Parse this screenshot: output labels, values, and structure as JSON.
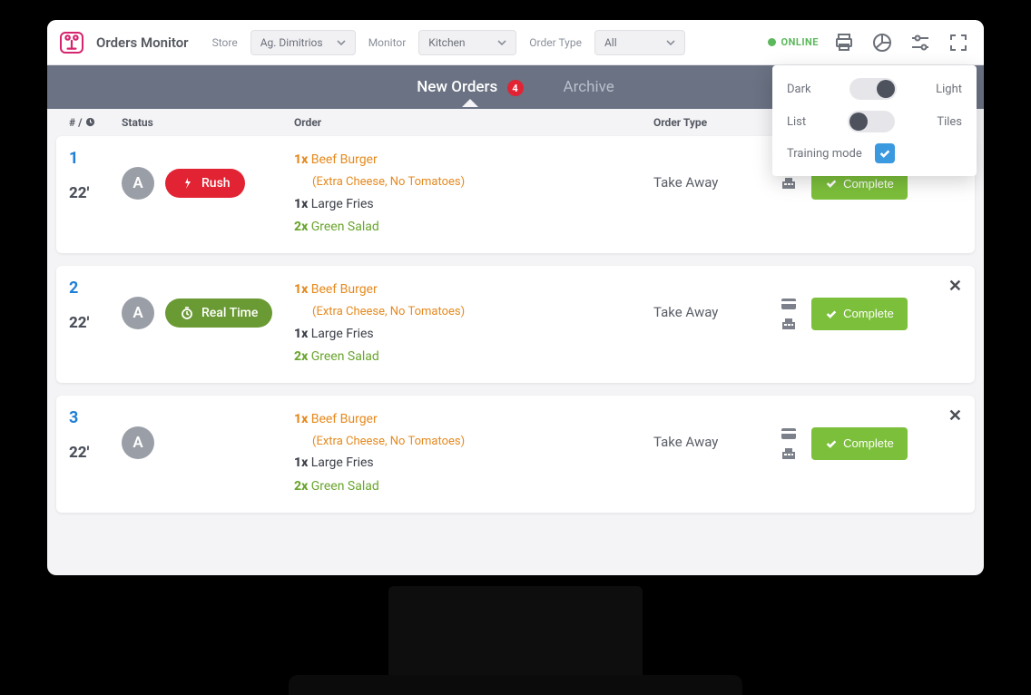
{
  "app": {
    "title": "Orders Monitor"
  },
  "topbar": {
    "store_label": "Store",
    "store_value": "Ag. Dimitrios",
    "monitor_label": "Monitor",
    "monitor_value": "Kitchen",
    "ordertype_label": "Order Type",
    "ordertype_value": "All",
    "status_text": "ONLINE"
  },
  "tabs": {
    "new_label": "New Orders",
    "new_badge": "4",
    "archive_label": "Archive"
  },
  "popover": {
    "dark_label": "Dark",
    "light_label": "Light",
    "list_label": "List",
    "tiles_label": "Tiles",
    "training_label": "Training mode"
  },
  "columns": {
    "num": "# /",
    "status": "Status",
    "order": "Order",
    "ordertype": "Order Type"
  },
  "colors": {
    "rush": "#e22333",
    "realtime": "#6a9a33",
    "accent_orange": "#e58a1f",
    "accent_green": "#6aa52e"
  },
  "orders": [
    {
      "num": "1",
      "time": "22'",
      "avatar": "A",
      "pill_label": "Rush",
      "pill_kind": "rush",
      "ordertype": "Take Away",
      "show_card_icon": false,
      "lines": [
        {
          "q": "1x",
          "name": "Beef Burger",
          "color": "#e58a1f",
          "mods": "(Extra Cheese, No Tomatoes)"
        },
        {
          "q": "1x",
          "name": "Large Fries",
          "color": "#3b3f47"
        },
        {
          "q": "2x",
          "name": "Green Salad",
          "color": "#6aa52e"
        }
      ],
      "complete_label": "Complete"
    },
    {
      "num": "2",
      "time": "22'",
      "avatar": "A",
      "pill_label": "Real Time",
      "pill_kind": "realtime",
      "ordertype": "Take Away",
      "show_card_icon": true,
      "lines": [
        {
          "q": "1x",
          "name": "Beef Burger",
          "color": "#e58a1f",
          "mods": "(Extra Cheese, No Tomatoes)"
        },
        {
          "q": "1x",
          "name": "Large Fries",
          "color": "#3b3f47"
        },
        {
          "q": "2x",
          "name": "Green Salad",
          "color": "#6aa52e"
        }
      ],
      "complete_label": "Complete"
    },
    {
      "num": "3",
      "time": "22'",
      "avatar": "A",
      "pill_label": "",
      "pill_kind": "",
      "ordertype": "Take Away",
      "show_card_icon": true,
      "lines": [
        {
          "q": "1x",
          "name": "Beef Burger",
          "color": "#e58a1f",
          "mods": "(Extra Cheese, No Tomatoes)"
        },
        {
          "q": "1x",
          "name": "Large Fries",
          "color": "#3b3f47"
        },
        {
          "q": "2x",
          "name": "Green Salad",
          "color": "#6aa52e"
        }
      ],
      "complete_label": "Complete"
    }
  ]
}
